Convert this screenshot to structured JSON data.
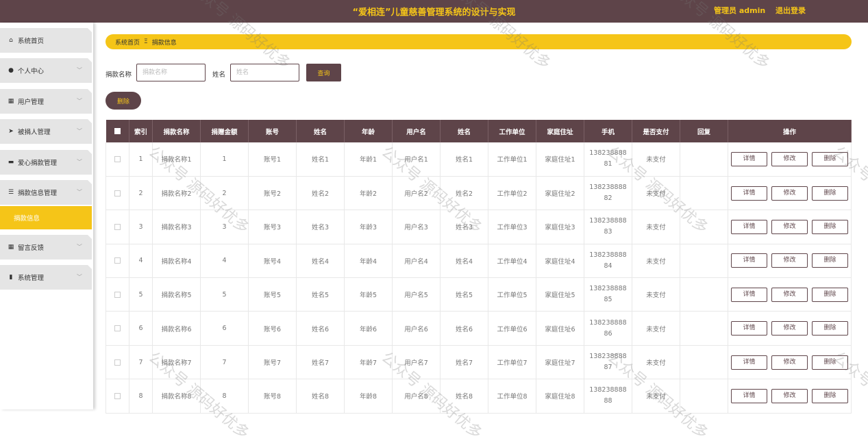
{
  "header": {
    "title": "“爱相连”儿童慈善管理系统的设计与实现",
    "admin": "管理员 admin",
    "logout": "退出登录"
  },
  "sidebar": {
    "items": [
      {
        "label": "系统首页",
        "icon": "home-icon",
        "glyph": "⌂",
        "has_chevron": false
      },
      {
        "label": "个人中心",
        "icon": "user-icon",
        "glyph": "●",
        "has_chevron": true
      },
      {
        "label": "用户管理",
        "icon": "grid-icon",
        "glyph": "▦",
        "has_chevron": true
      },
      {
        "label": "被捐人管理",
        "icon": "send-icon",
        "glyph": "➤",
        "has_chevron": true
      },
      {
        "label": "爱心捐款管理",
        "icon": "ticket-icon",
        "glyph": "▬",
        "has_chevron": true
      },
      {
        "label": "捐款信息管理",
        "icon": "sliders-icon",
        "glyph": "☰",
        "has_chevron": true
      },
      {
        "label": "留言反馈",
        "icon": "grid-icon",
        "glyph": "▦",
        "has_chevron": true
      },
      {
        "label": "系统管理",
        "icon": "bar-chart-icon",
        "glyph": "▮",
        "has_chevron": true
      }
    ],
    "active_sub": "捐款信息"
  },
  "breadcrumb": {
    "home": "系统首页",
    "separator": "Ξ",
    "current": "捐款信息"
  },
  "search": {
    "field1_label": "捐款名称",
    "field1_placeholder": "捐款名称",
    "field2_label": "姓名",
    "field2_placeholder": "姓名",
    "query_label": "查询"
  },
  "actions": {
    "delete_label": "删除"
  },
  "table": {
    "headers": [
      "索引",
      "捐款名称",
      "捐赠金额",
      "账号",
      "姓名",
      "年龄",
      "用户名",
      "姓名",
      "工作单位",
      "家庭住址",
      "手机",
      "是否支付",
      "回复",
      "操作"
    ],
    "op_labels": {
      "detail": "详情",
      "edit": "修改",
      "delete": "删除"
    },
    "rows": [
      {
        "index": "1",
        "name": "捐款名称1",
        "amount": "1",
        "account": "账号1",
        "person": "姓名1",
        "age": "年龄1",
        "username": "用户名1",
        "person2": "姓名1",
        "work": "工作单位1",
        "address": "家庭住址1",
        "phone": "13823888881",
        "paid": "未支付",
        "reply": ""
      },
      {
        "index": "2",
        "name": "捐款名称2",
        "amount": "2",
        "account": "账号2",
        "person": "姓名2",
        "age": "年龄2",
        "username": "用户名2",
        "person2": "姓名2",
        "work": "工作单位2",
        "address": "家庭住址2",
        "phone": "13823888882",
        "paid": "未支付",
        "reply": ""
      },
      {
        "index": "3",
        "name": "捐款名称3",
        "amount": "3",
        "account": "账号3",
        "person": "姓名3",
        "age": "年龄3",
        "username": "用户名3",
        "person2": "姓名3",
        "work": "工作单位3",
        "address": "家庭住址3",
        "phone": "13823888883",
        "paid": "未支付",
        "reply": ""
      },
      {
        "index": "4",
        "name": "捐款名称4",
        "amount": "4",
        "account": "账号4",
        "person": "姓名4",
        "age": "年龄4",
        "username": "用户名4",
        "person2": "姓名4",
        "work": "工作单位4",
        "address": "家庭住址4",
        "phone": "13823888884",
        "paid": "未支付",
        "reply": ""
      },
      {
        "index": "5",
        "name": "捐款名称5",
        "amount": "5",
        "account": "账号5",
        "person": "姓名5",
        "age": "年龄5",
        "username": "用户名5",
        "person2": "姓名5",
        "work": "工作单位5",
        "address": "家庭住址5",
        "phone": "13823888885",
        "paid": "未支付",
        "reply": ""
      },
      {
        "index": "6",
        "name": "捐款名称6",
        "amount": "6",
        "account": "账号6",
        "person": "姓名6",
        "age": "年龄6",
        "username": "用户名6",
        "person2": "姓名6",
        "work": "工作单位6",
        "address": "家庭住址6",
        "phone": "13823888886",
        "paid": "未支付",
        "reply": ""
      },
      {
        "index": "7",
        "name": "捐款名称7",
        "amount": "7",
        "account": "账号7",
        "person": "姓名7",
        "age": "年龄7",
        "username": "用户名7",
        "person2": "姓名7",
        "work": "工作单位7",
        "address": "家庭住址7",
        "phone": "13823888887",
        "paid": "未支付",
        "reply": ""
      },
      {
        "index": "8",
        "name": "捐款名称8",
        "amount": "8",
        "account": "账号8",
        "person": "姓名8",
        "age": "年龄8",
        "username": "用户名8",
        "person2": "姓名8",
        "work": "工作单位8",
        "address": "家庭住址8",
        "phone": "13823888888",
        "paid": "未支付",
        "reply": ""
      }
    ]
  },
  "watermark": {
    "text": "公众号 源码好优多"
  },
  "colors": {
    "header_bg": "#5e4449",
    "accent": "#f5c518",
    "menu_bg": "#e5e5e5"
  }
}
